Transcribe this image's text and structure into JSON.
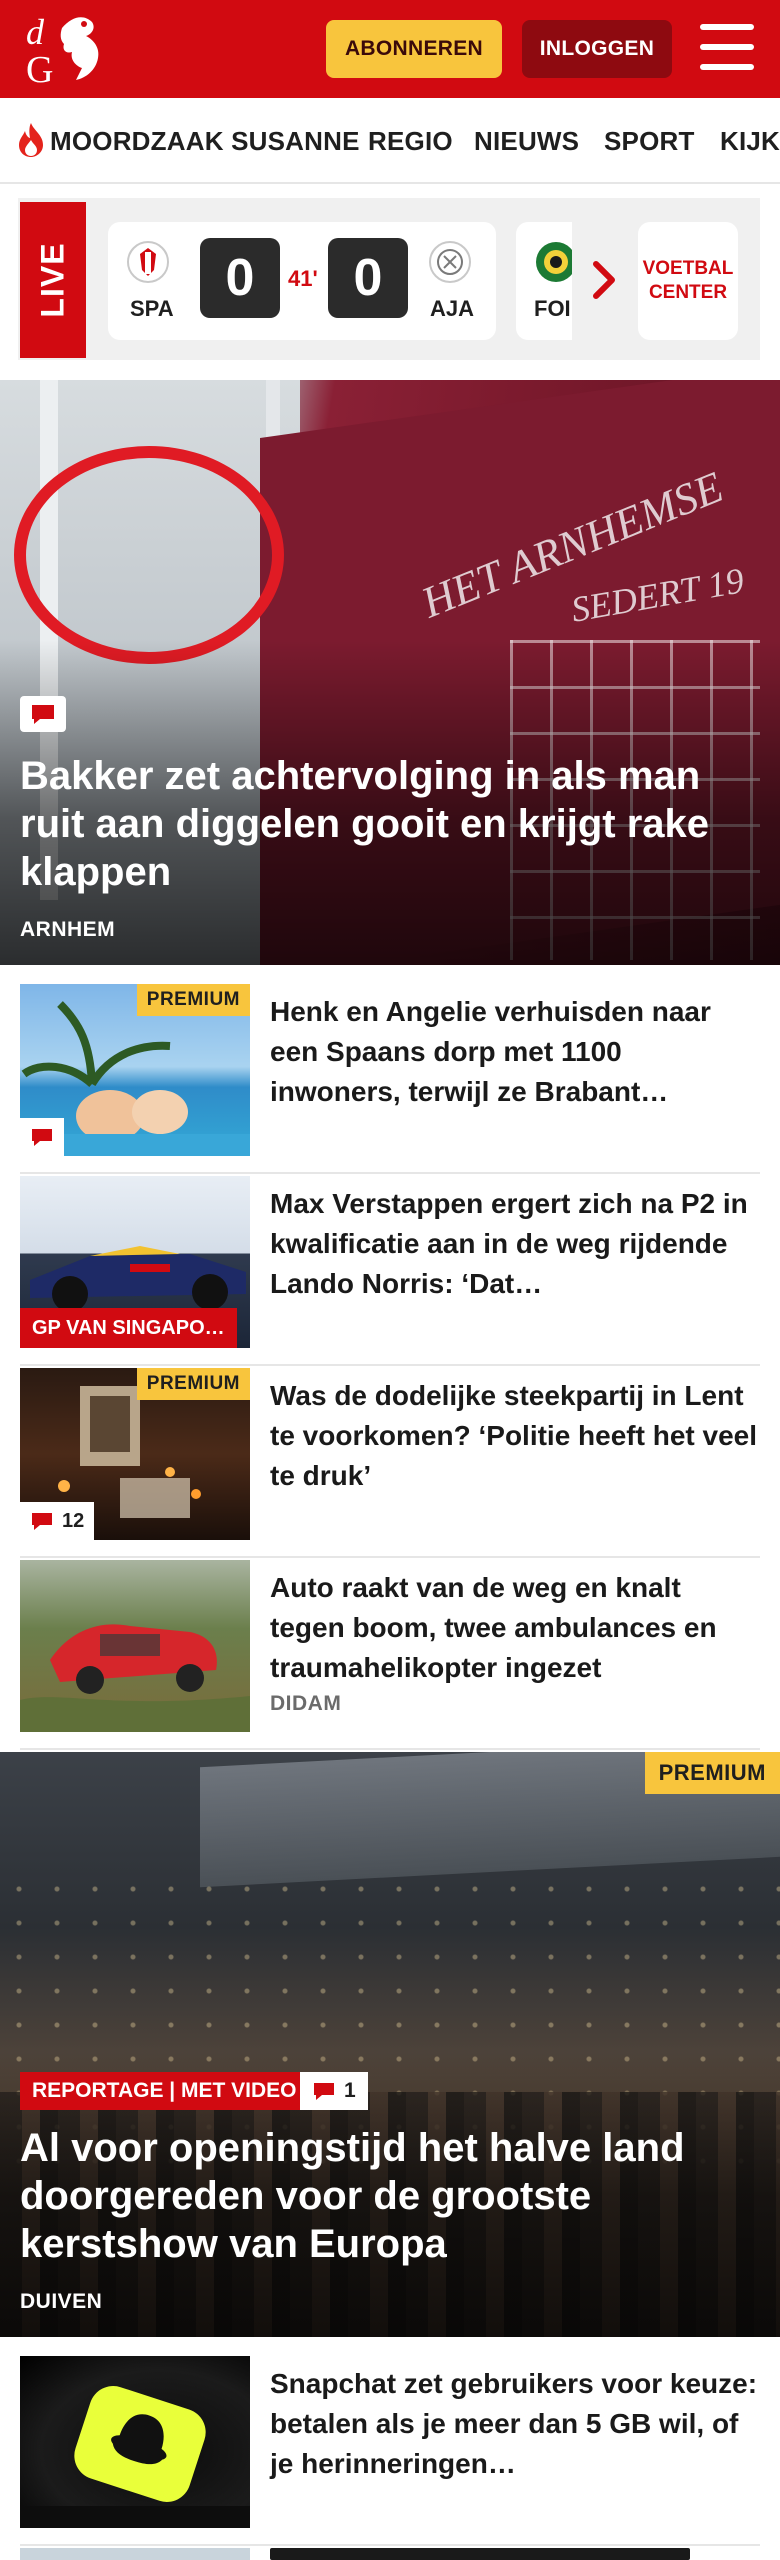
{
  "header": {
    "logo_text": "dG",
    "subscribe_label": "ABONNEREN",
    "login_label": "INLOGGEN"
  },
  "nav": {
    "items": [
      "MOORDZAAK SUSANNE",
      "REGIO",
      "NIEUWS",
      "SPORT",
      "KIJK"
    ]
  },
  "live": {
    "label": "LIVE",
    "match": {
      "home_code": "SPA",
      "home_score": "0",
      "minute": "41'",
      "away_score": "0",
      "away_code": "AJA"
    },
    "next_code": "FOI",
    "center_label": "VOETBAL CENTER"
  },
  "hero": {
    "title": "Bakker zet achtervolging in als man ruit aan diggelen gooit en krijgt rake klappen",
    "location": "ARNHEM",
    "sign_line1": "HET ARNHEMSE",
    "sign_line2": "SEDERT 19"
  },
  "articles": [
    {
      "title": "Henk en Angelie verhuisden naar een Spaans dorp met 1100 inwoners, terwijl ze Brabant…",
      "premium": "PREMIUM",
      "comments": "",
      "label": "",
      "location": ""
    },
    {
      "title": "Max Verstappen ergert zich na P2 in kwalificatie aan in de weg rijdende Lando Norris: ‘Dat…",
      "premium": "",
      "comments": "",
      "label": "GP VAN SINGAPO…",
      "location": ""
    },
    {
      "title": "Was de dodelijke steekpartij in Lent te voorkomen? ‘Politie heeft het veel te druk’",
      "premium": "PREMIUM",
      "comments": "12",
      "label": "",
      "location": ""
    },
    {
      "title": "Auto raakt van de weg en knalt tegen boom, twee ambulances en traumahelikopter ingezet",
      "premium": "",
      "comments": "",
      "label": "",
      "location": "DIDAM"
    }
  ],
  "feature": {
    "premium": "PREMIUM",
    "tag": "REPORTAGE | MET VIDEO",
    "comments": "1",
    "title": "Al voor openingstijd het halve land doorgereden voor de grootste kerstshow van Europa",
    "location": "DUIVEN"
  },
  "article_after": {
    "title": "Snapchat zet gebruikers voor keuze: betalen als je meer dan 5 GB wil, of je herinneringen…"
  },
  "colors": {
    "brand_red": "#d10a11",
    "premium_yellow": "#f8c53d",
    "dark_red": "#8e0a10"
  },
  "icons": [
    "menu-icon",
    "flame-icon",
    "comment-icon",
    "chevron-right-icon"
  ]
}
